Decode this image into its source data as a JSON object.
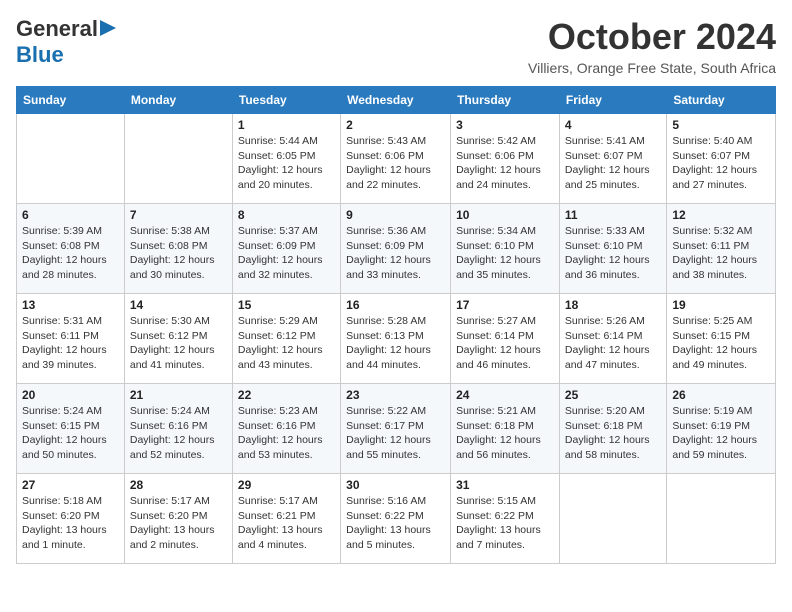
{
  "header": {
    "logo_general": "General",
    "logo_blue": "Blue",
    "month_title": "October 2024",
    "location": "Villiers, Orange Free State, South Africa"
  },
  "days_of_week": [
    "Sunday",
    "Monday",
    "Tuesday",
    "Wednesday",
    "Thursday",
    "Friday",
    "Saturday"
  ],
  "weeks": [
    [
      {
        "day": "",
        "content": ""
      },
      {
        "day": "",
        "content": ""
      },
      {
        "day": "1",
        "content": "Sunrise: 5:44 AM\nSunset: 6:05 PM\nDaylight: 12 hours and 20 minutes."
      },
      {
        "day": "2",
        "content": "Sunrise: 5:43 AM\nSunset: 6:06 PM\nDaylight: 12 hours and 22 minutes."
      },
      {
        "day": "3",
        "content": "Sunrise: 5:42 AM\nSunset: 6:06 PM\nDaylight: 12 hours and 24 minutes."
      },
      {
        "day": "4",
        "content": "Sunrise: 5:41 AM\nSunset: 6:07 PM\nDaylight: 12 hours and 25 minutes."
      },
      {
        "day": "5",
        "content": "Sunrise: 5:40 AM\nSunset: 6:07 PM\nDaylight: 12 hours and 27 minutes."
      }
    ],
    [
      {
        "day": "6",
        "content": "Sunrise: 5:39 AM\nSunset: 6:08 PM\nDaylight: 12 hours and 28 minutes."
      },
      {
        "day": "7",
        "content": "Sunrise: 5:38 AM\nSunset: 6:08 PM\nDaylight: 12 hours and 30 minutes."
      },
      {
        "day": "8",
        "content": "Sunrise: 5:37 AM\nSunset: 6:09 PM\nDaylight: 12 hours and 32 minutes."
      },
      {
        "day": "9",
        "content": "Sunrise: 5:36 AM\nSunset: 6:09 PM\nDaylight: 12 hours and 33 minutes."
      },
      {
        "day": "10",
        "content": "Sunrise: 5:34 AM\nSunset: 6:10 PM\nDaylight: 12 hours and 35 minutes."
      },
      {
        "day": "11",
        "content": "Sunrise: 5:33 AM\nSunset: 6:10 PM\nDaylight: 12 hours and 36 minutes."
      },
      {
        "day": "12",
        "content": "Sunrise: 5:32 AM\nSunset: 6:11 PM\nDaylight: 12 hours and 38 minutes."
      }
    ],
    [
      {
        "day": "13",
        "content": "Sunrise: 5:31 AM\nSunset: 6:11 PM\nDaylight: 12 hours and 39 minutes."
      },
      {
        "day": "14",
        "content": "Sunrise: 5:30 AM\nSunset: 6:12 PM\nDaylight: 12 hours and 41 minutes."
      },
      {
        "day": "15",
        "content": "Sunrise: 5:29 AM\nSunset: 6:12 PM\nDaylight: 12 hours and 43 minutes."
      },
      {
        "day": "16",
        "content": "Sunrise: 5:28 AM\nSunset: 6:13 PM\nDaylight: 12 hours and 44 minutes."
      },
      {
        "day": "17",
        "content": "Sunrise: 5:27 AM\nSunset: 6:14 PM\nDaylight: 12 hours and 46 minutes."
      },
      {
        "day": "18",
        "content": "Sunrise: 5:26 AM\nSunset: 6:14 PM\nDaylight: 12 hours and 47 minutes."
      },
      {
        "day": "19",
        "content": "Sunrise: 5:25 AM\nSunset: 6:15 PM\nDaylight: 12 hours and 49 minutes."
      }
    ],
    [
      {
        "day": "20",
        "content": "Sunrise: 5:24 AM\nSunset: 6:15 PM\nDaylight: 12 hours and 50 minutes."
      },
      {
        "day": "21",
        "content": "Sunrise: 5:24 AM\nSunset: 6:16 PM\nDaylight: 12 hours and 52 minutes."
      },
      {
        "day": "22",
        "content": "Sunrise: 5:23 AM\nSunset: 6:16 PM\nDaylight: 12 hours and 53 minutes."
      },
      {
        "day": "23",
        "content": "Sunrise: 5:22 AM\nSunset: 6:17 PM\nDaylight: 12 hours and 55 minutes."
      },
      {
        "day": "24",
        "content": "Sunrise: 5:21 AM\nSunset: 6:18 PM\nDaylight: 12 hours and 56 minutes."
      },
      {
        "day": "25",
        "content": "Sunrise: 5:20 AM\nSunset: 6:18 PM\nDaylight: 12 hours and 58 minutes."
      },
      {
        "day": "26",
        "content": "Sunrise: 5:19 AM\nSunset: 6:19 PM\nDaylight: 12 hours and 59 minutes."
      }
    ],
    [
      {
        "day": "27",
        "content": "Sunrise: 5:18 AM\nSunset: 6:20 PM\nDaylight: 13 hours and 1 minute."
      },
      {
        "day": "28",
        "content": "Sunrise: 5:17 AM\nSunset: 6:20 PM\nDaylight: 13 hours and 2 minutes."
      },
      {
        "day": "29",
        "content": "Sunrise: 5:17 AM\nSunset: 6:21 PM\nDaylight: 13 hours and 4 minutes."
      },
      {
        "day": "30",
        "content": "Sunrise: 5:16 AM\nSunset: 6:22 PM\nDaylight: 13 hours and 5 minutes."
      },
      {
        "day": "31",
        "content": "Sunrise: 5:15 AM\nSunset: 6:22 PM\nDaylight: 13 hours and 7 minutes."
      },
      {
        "day": "",
        "content": ""
      },
      {
        "day": "",
        "content": ""
      }
    ]
  ]
}
